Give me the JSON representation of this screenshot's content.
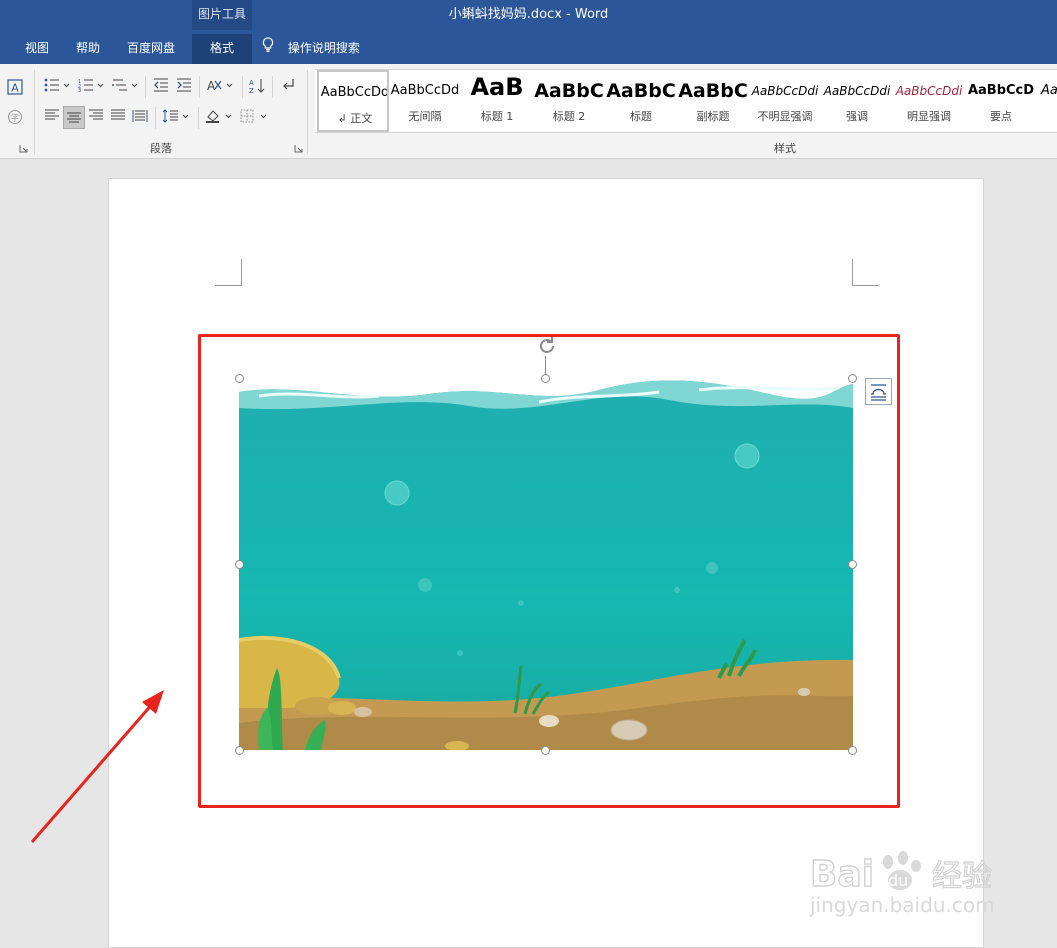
{
  "window": {
    "doc_title": "小蝌蚪找妈妈.docx  -  Word",
    "context_group": "图片工具"
  },
  "tabs": [
    {
      "label": "视图"
    },
    {
      "label": "帮助"
    },
    {
      "label": "百度网盘"
    },
    {
      "label": "格式",
      "active": true
    }
  ],
  "tell_me": {
    "label": "操作说明搜索",
    "icon": "lightbulb-icon"
  },
  "ribbon": {
    "groups": {
      "paragraph": "段落",
      "styles": "样式"
    },
    "styles": [
      {
        "preview": "AaBbCcDd",
        "name": "↲ 正文"
      },
      {
        "preview": "AaBbCcDd",
        "name": "无间隔"
      },
      {
        "preview": "AaB",
        "name": "标题 1"
      },
      {
        "preview": "AaBbC",
        "name": "标题 2"
      },
      {
        "preview": "AaBbC",
        "name": "标题"
      },
      {
        "preview": "AaBbC",
        "name": "副标题"
      },
      {
        "preview": "AaBbCcDdi",
        "name": "不明显强调"
      },
      {
        "preview": "AaBbCcDdi",
        "name": "强调"
      },
      {
        "preview": "AaBbCcDdi",
        "name": "明显强调"
      },
      {
        "preview": "AaBbCcD",
        "name": "要点"
      },
      {
        "preview": "Aa",
        "name": ""
      }
    ],
    "colors": {
      "accent": "#2b579a",
      "intense_emphasis": "#a5233c"
    }
  },
  "selection": {
    "highlight_color": "#e8251d"
  },
  "watermark": {
    "logo": "Bai du 经验",
    "url": "jingyan.baidu.com"
  }
}
